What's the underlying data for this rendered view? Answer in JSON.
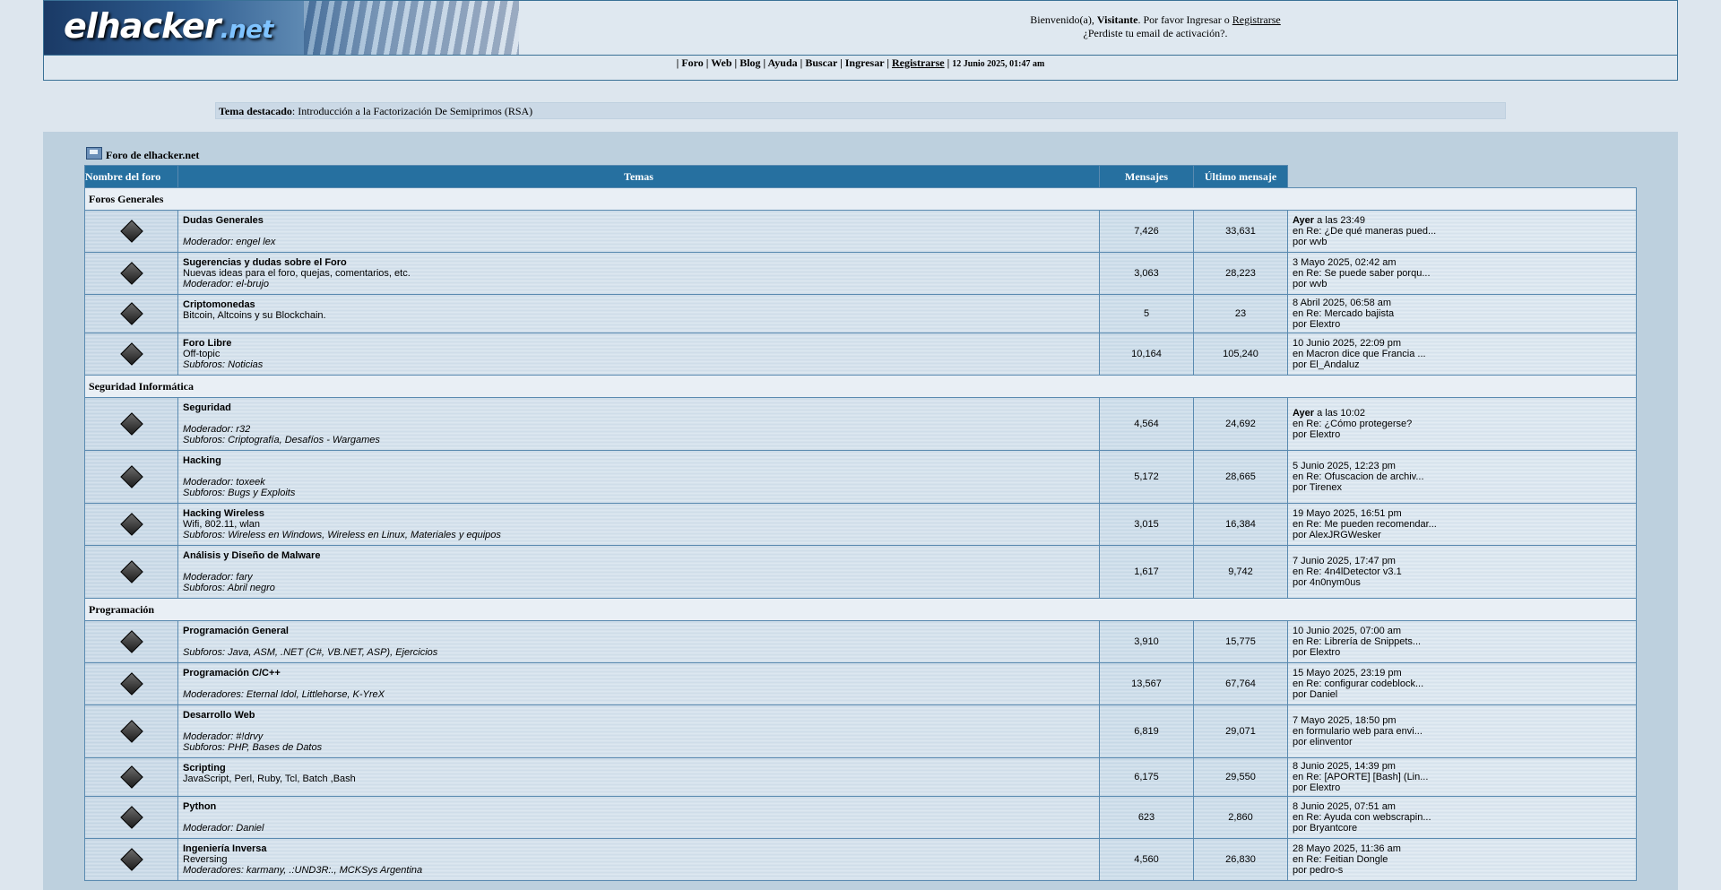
{
  "header": {
    "logo_main": "elhacker",
    "logo_net": ".net",
    "welcome_prefix": "Bienvenido(a), ",
    "welcome_user": "Visitante",
    "welcome_middle": ". Por favor Ingresar o ",
    "welcome_register": "Registrarse",
    "activation_text": "¿Perdiste tu email de activación?."
  },
  "nav": {
    "items": [
      "Foro",
      "Web",
      "Blog",
      "Ayuda",
      "Buscar",
      "Ingresar",
      "Registrarse"
    ],
    "date": "12 Junio 2025, 01:47 am"
  },
  "featured": {
    "label": "Tema destacado",
    "text": ": Introducción a la Factorización De Semiprimos (RSA)"
  },
  "breadcrumb": "Foro de elhacker.net",
  "table_headers": {
    "name": "Nombre del foro",
    "topics": "Temas",
    "posts": "Mensajes",
    "last": "Último mensaje"
  },
  "categories": [
    {
      "name": "Foros Generales",
      "forums": [
        {
          "name": "Dudas Generales",
          "desc": "",
          "mods": "Moderador: engel lex",
          "subs": "",
          "topics": "7,426",
          "posts": "33,631",
          "last_when_bold": "Ayer",
          "last_when_rest": " a las 23:49",
          "last_in": "en Re: ¿De qué maneras pued...",
          "last_by": "por wvb"
        },
        {
          "name": "Sugerencias y dudas sobre el Foro",
          "desc": "Nuevas ideas para el foro, quejas, comentarios, etc.",
          "mods": "Moderador: el-brujo",
          "subs": "",
          "topics": "3,063",
          "posts": "28,223",
          "last_when_bold": "",
          "last_when_rest": "3 Mayo 2025, 02:42 am",
          "last_in": "en Re: Se puede saber porqu...",
          "last_by": "por wvb"
        },
        {
          "name": "Criptomonedas",
          "desc": "Bitcoin, Altcoins y su Blockchain.",
          "mods": "",
          "subs": "",
          "topics": "5",
          "posts": "23",
          "last_when_bold": "",
          "last_when_rest": "8 Abril 2025, 06:58 am",
          "last_in": "en Re: Mercado bajista",
          "last_by": "por Elextro"
        },
        {
          "name": "Foro Libre",
          "desc": "Off-topic",
          "mods": "",
          "subs": "Subforos: Noticias",
          "topics": "10,164",
          "posts": "105,240",
          "last_when_bold": "",
          "last_when_rest": "10 Junio 2025, 22:09 pm",
          "last_in": "en Macron dice que Francia ...",
          "last_by": "por El_Andaluz"
        }
      ]
    },
    {
      "name": "Seguridad Informática",
      "forums": [
        {
          "name": "Seguridad",
          "desc": "",
          "mods": "Moderador: r32",
          "subs": "Subforos: Criptografía, Desafíos - Wargames",
          "topics": "4,564",
          "posts": "24,692",
          "last_when_bold": "Ayer",
          "last_when_rest": " a las 10:02",
          "last_in": "en Re: ¿Cómo protegerse?",
          "last_by": "por Elextro"
        },
        {
          "name": "Hacking",
          "desc": "",
          "mods": "Moderador: toxeek",
          "subs": "Subforos: Bugs y Exploits",
          "topics": "5,172",
          "posts": "28,665",
          "last_when_bold": "",
          "last_when_rest": "5 Junio 2025, 12:23 pm",
          "last_in": "en Re: Ofuscacion de archiv...",
          "last_by": "por Tirenex"
        },
        {
          "name": "Hacking Wireless",
          "desc": "Wifi, 802.11, wlan",
          "mods": "",
          "subs": "Subforos: Wireless en Windows, Wireless en Linux, Materiales y equipos",
          "topics": "3,015",
          "posts": "16,384",
          "last_when_bold": "",
          "last_when_rest": "19 Mayo 2025, 16:51 pm",
          "last_in": "en Re: Me pueden recomendar...",
          "last_by": "por AlexJRGWesker"
        },
        {
          "name": "Análisis y Diseño de Malware",
          "desc": "",
          "mods": "Moderador: fary",
          "subs": "Subforos: Abril negro",
          "topics": "1,617",
          "posts": "9,742",
          "last_when_bold": "",
          "last_when_rest": "7 Junio 2025, 17:47 pm",
          "last_in": "en Re: 4n4lDetector v3.1",
          "last_by": "por 4n0nym0us"
        }
      ]
    },
    {
      "name": "Programación",
      "forums": [
        {
          "name": "Programación General",
          "desc": "",
          "mods": "",
          "subs": "Subforos: Java, ASM, .NET (C#, VB.NET, ASP), Ejercicios",
          "topics": "3,910",
          "posts": "15,775",
          "last_when_bold": "",
          "last_when_rest": "10 Junio 2025, 07:00 am",
          "last_in": "en Re: Librería de Snippets...",
          "last_by": "por Elextro"
        },
        {
          "name": "Programación C/C++",
          "desc": "",
          "mods": "Moderadores: Eternal Idol, Littlehorse, K-YreX",
          "subs": "",
          "topics": "13,567",
          "posts": "67,764",
          "last_when_bold": "",
          "last_when_rest": "15 Mayo 2025, 23:19 pm",
          "last_in": "en Re: configurar codeblock...",
          "last_by": "por Daniel"
        },
        {
          "name": "Desarrollo Web",
          "desc": "",
          "mods": "Moderador: #!drvy",
          "subs": "Subforos: PHP, Bases de Datos",
          "topics": "6,819",
          "posts": "29,071",
          "last_when_bold": "",
          "last_when_rest": "7 Mayo 2025, 18:50 pm",
          "last_in": "en formulario web para envi...",
          "last_by": "por elinventor"
        },
        {
          "name": "Scripting",
          "desc": "JavaScript, Perl, Ruby, Tcl, Batch ,Bash",
          "mods": "",
          "subs": "",
          "topics": "6,175",
          "posts": "29,550",
          "last_when_bold": "",
          "last_when_rest": "8 Junio 2025, 14:39 pm",
          "last_in": "en Re: [APORTE] [Bash] (Lin...",
          "last_by": "por Elextro"
        },
        {
          "name": "Python",
          "desc": "",
          "mods": "Moderador: Daniel",
          "subs": "",
          "topics": "623",
          "posts": "2,860",
          "last_when_bold": "",
          "last_when_rest": "8 Junio 2025, 07:51 am",
          "last_in": "en Re: Ayuda con webscrapin...",
          "last_by": "por Bryantcore"
        },
        {
          "name": "Ingeniería Inversa",
          "desc": "Reversing",
          "mods": "Moderadores: karmany, .:UND3R:., MCKSys Argentina",
          "subs": "",
          "topics": "4,560",
          "posts": "26,830",
          "last_when_bold": "",
          "last_when_rest": "28 Mayo 2025, 11:36 am",
          "last_in": "en Re: Feitian Dongle",
          "last_by": "por pedro-s"
        }
      ]
    }
  ]
}
